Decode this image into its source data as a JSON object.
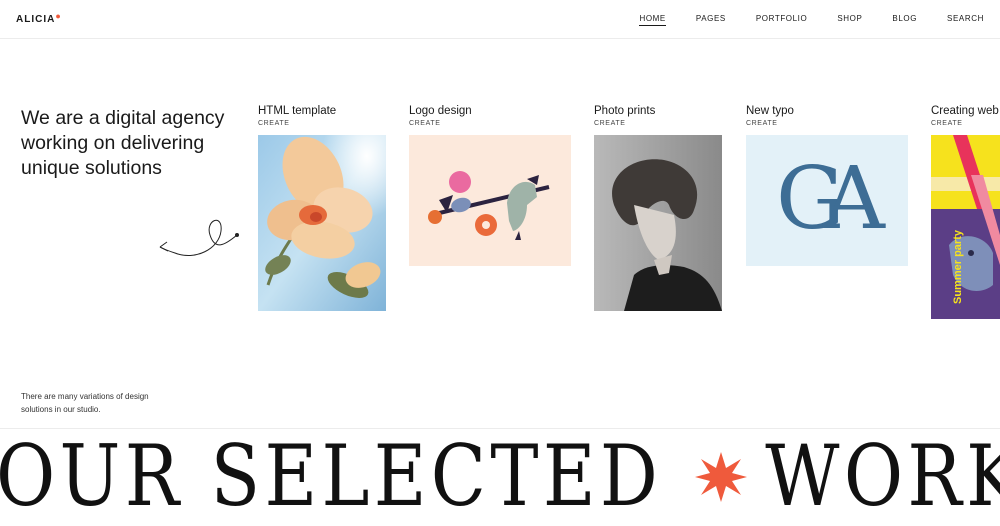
{
  "header": {
    "logo": "ALICIA",
    "nav": [
      "HOME",
      "PAGES",
      "PORTFOLIO",
      "SHOP",
      "BLOG",
      "SEARCH"
    ]
  },
  "hero": {
    "heading": "We are a digital agency working on delivering unique solutions"
  },
  "portfolio": [
    {
      "title": "HTML template",
      "category": "CREATE"
    },
    {
      "title": "Logo design",
      "category": "CREATE"
    },
    {
      "title": "Photo prints",
      "category": "CREATE"
    },
    {
      "title": "New typo",
      "category": "CREATE"
    },
    {
      "title": "Creating web",
      "category": "CREATE"
    }
  ],
  "typo_letters": "GA",
  "poster_text": "Summer party",
  "description": "There are many variations of design solutions in our studio.",
  "marquee": {
    "left": "OUR SELECTED",
    "right": "WORK"
  },
  "colors": {
    "accent": "#ef5a3c",
    "logo_card_bg": "#fce9dc",
    "typo_card_bg": "#e3f1f8",
    "typo_letter": "#3d6d95"
  }
}
